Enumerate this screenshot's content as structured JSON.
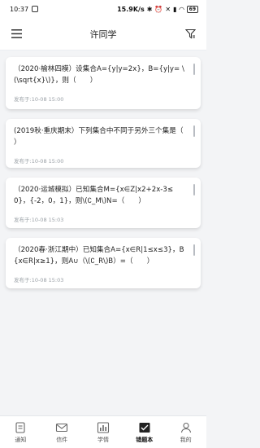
{
  "status": {
    "time": "10:37",
    "speed": "15.9K/s",
    "battery": "69"
  },
  "header": {
    "title": "许同学"
  },
  "questions": [
    {
      "text": "（2020·榆林四模）设集合A={y|y=2x}，B={y|y= \\(\\sqrt{x}\\)}，则（　　）",
      "meta": "发布于:10-08 15:00"
    },
    {
      "text": "(2019秋·重庆期末）下列集合中不同于另外三个集是（　　）",
      "meta": "发布于:10-08 15:00"
    },
    {
      "text": "（2020·运城模拟）已知集合M={x∈Z|x2+2x-3≤0}，{-2，0，1}，则\\(∁_M\\)N=（　　）",
      "meta": "发布于:10-08 15:03"
    },
    {
      "text": "（2020春·浙江期中）已知集合A={x∈R|1≤x≤3}，B{x∈R|x≥1}，则A∪（\\(∁_R\\)B）=（　　）",
      "meta": "发布于:10-08 15:03"
    }
  ],
  "tabs": [
    {
      "label": "通知",
      "icon": "notification-icon"
    },
    {
      "label": "信件",
      "icon": "mail-icon"
    },
    {
      "label": "学情",
      "icon": "chart-icon"
    },
    {
      "label": "错题本",
      "icon": "wrongbook-icon"
    },
    {
      "label": "我的",
      "icon": "user-icon"
    }
  ],
  "colors": {
    "active": "#222222",
    "inactive": "#666666",
    "background": "#f3f4f6"
  }
}
